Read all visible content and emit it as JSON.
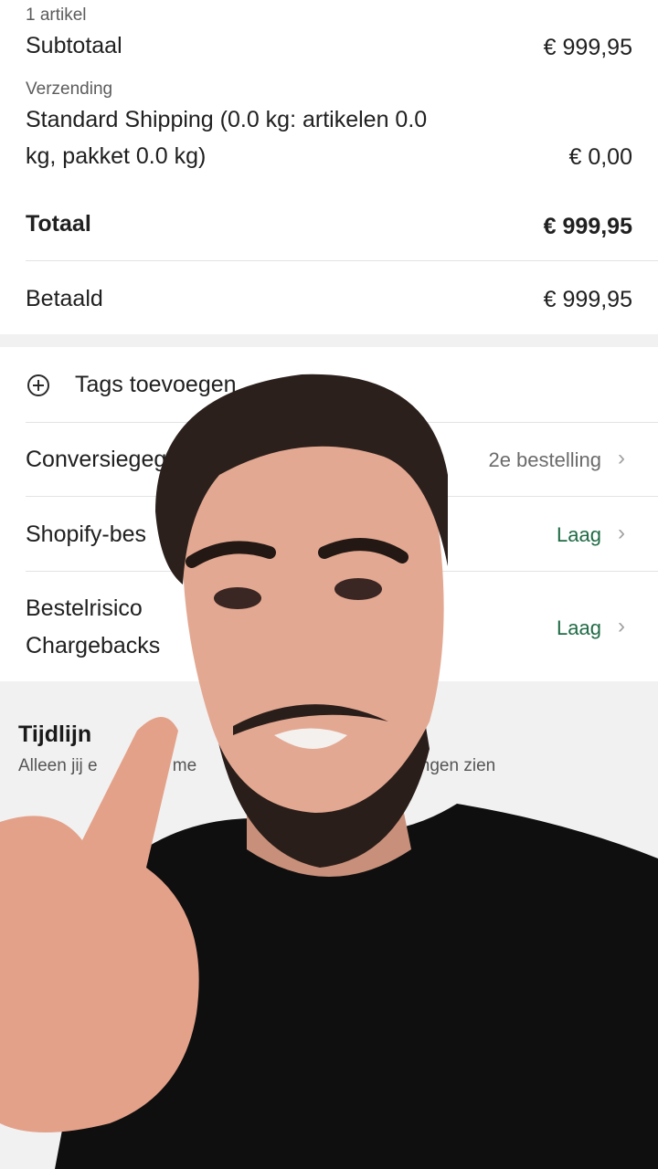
{
  "summary": {
    "items_count_label": "1 artikel",
    "subtotal_label": "Subtotaal",
    "subtotal_value": "€ 999,95",
    "shipping_section_label": "Verzending",
    "shipping_line1": "Standard Shipping (0.0 kg: artikelen 0.0",
    "shipping_line2": "kg, pakket 0.0 kg)",
    "shipping_value": "€ 0,00",
    "total_label": "Totaal",
    "total_value": "€ 999,95",
    "paid_label": "Betaald",
    "paid_value": "€ 999,95"
  },
  "actions": {
    "add_tags_label": "Tags toevoegen",
    "conversion_label": "Conversiegeg",
    "conversion_value": "2e bestelling",
    "shopify_label": "Shopify-bes",
    "shopify_value": "Laag",
    "risk_label_line1": "Bestelrisico",
    "risk_label_line2": "Chargebacks",
    "risk_value": "Laag"
  },
  "timeline": {
    "title": "Tijdlijn",
    "subtitle_part1": "Alleen jij e",
    "subtitle_part2": "re me",
    "subtitle_part3": "erkingen zien"
  },
  "colors": {
    "status_green": "#1f6b45",
    "background_gray": "#f1f1f1"
  }
}
